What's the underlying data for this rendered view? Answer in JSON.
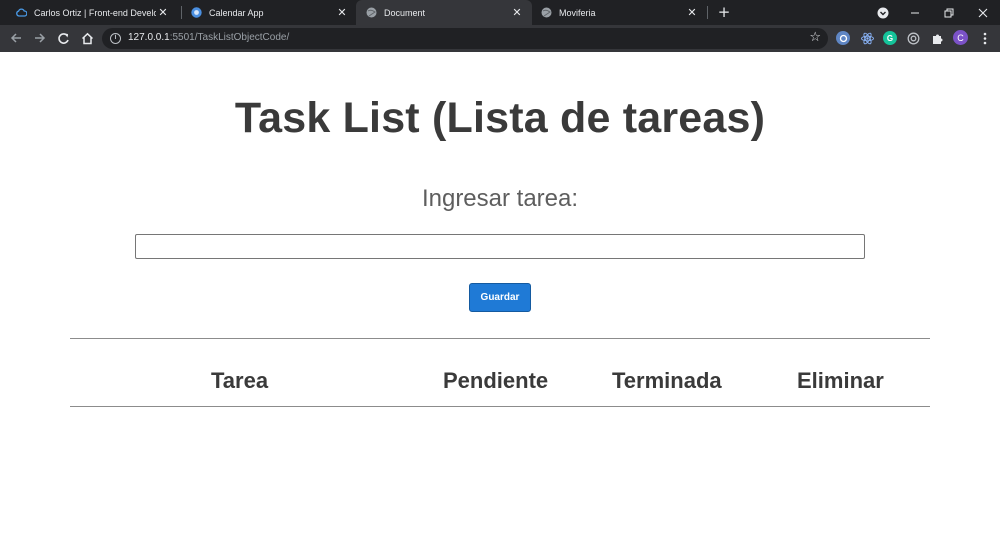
{
  "browser": {
    "tabs": [
      {
        "title": "Carlos Ortiz | Front-end Develop",
        "icon": "cloud-icon",
        "active": false
      },
      {
        "title": "Calendar App",
        "icon": "calendar-app-icon",
        "active": false
      },
      {
        "title": "Document",
        "icon": "globe-icon",
        "active": true
      },
      {
        "title": "Moviferia",
        "icon": "globe-icon",
        "active": false
      }
    ],
    "address": {
      "host": "127.0.0.1",
      "rest": ":5501/TaskListObjectCode/"
    },
    "profile_initial": "C",
    "extension_g_label": "G"
  },
  "page": {
    "title": "Task List (Lista de tareas)",
    "input_label": "Ingresar tarea:",
    "task_input_value": "",
    "save_button": "Guardar",
    "columns": [
      "Tarea",
      "Pendiente",
      "Terminada",
      "Eliminar"
    ]
  },
  "colors": {
    "accent_button": "#1f7ad6",
    "heading_text": "#3a3a3a",
    "chrome_dark": "#202124",
    "chrome_toolbar": "#35363a",
    "profile_avatar": "#7b52c7",
    "extension_g": "#15c39a"
  }
}
